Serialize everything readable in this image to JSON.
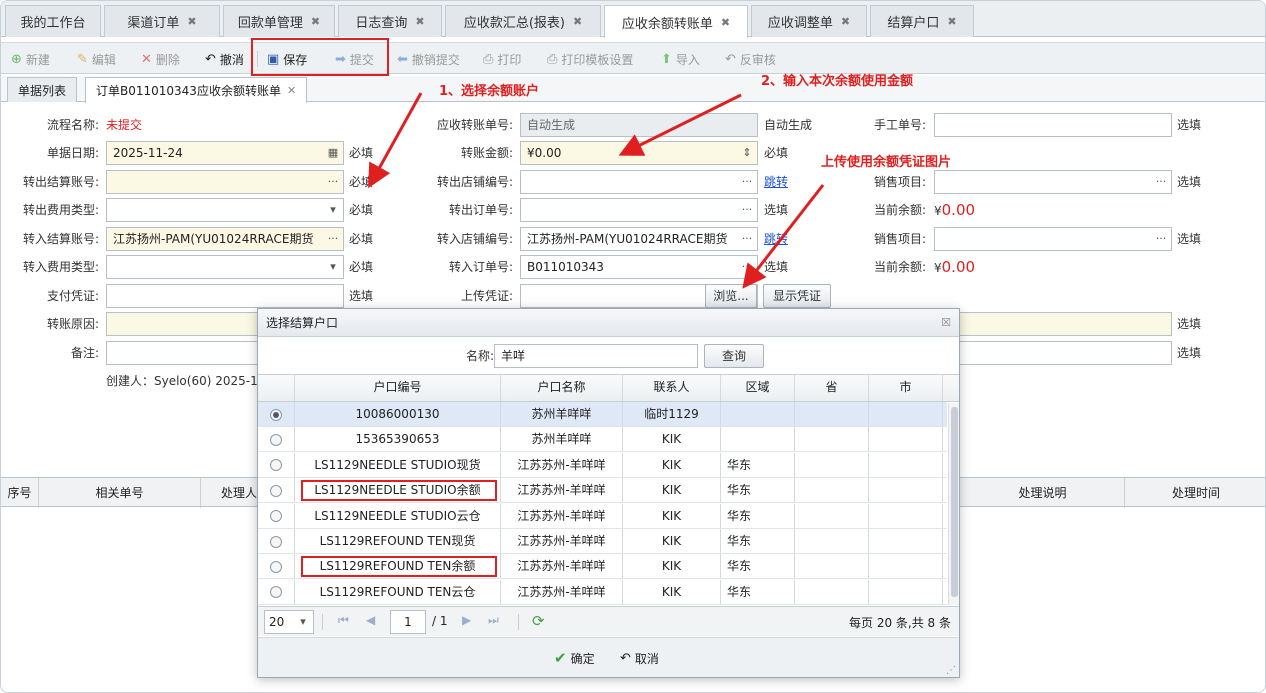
{
  "tabs": [
    {
      "label": "我的工作台",
      "closable": false
    },
    {
      "label": "渠道订单",
      "closable": true
    },
    {
      "label": "回款单管理",
      "closable": true
    },
    {
      "label": "日志查询",
      "closable": true
    },
    {
      "label": "应收款汇总(报表)",
      "closable": true
    },
    {
      "label": "应收余额转账单",
      "closable": true,
      "active": true
    },
    {
      "label": "应收调整单",
      "closable": true
    },
    {
      "label": "结算户口",
      "closable": true
    }
  ],
  "close_glyph": "✖",
  "toolbar": {
    "new": "新建",
    "edit": "编辑",
    "delete": "删除",
    "undo": "撤消",
    "save": "保存",
    "submit": "提交",
    "revoke_submit": "撤销提交",
    "print": "打印",
    "print_template": "打印模板设置",
    "import": "导入",
    "unaudit": "反审核"
  },
  "subtabs": {
    "list": "单据列表",
    "doc": "订单B011010343应收余额转账单"
  },
  "form": {
    "flow_name_label": "流程名称:",
    "flow_name_value": "未提交",
    "doc_date_label": "单据日期:",
    "doc_date_value": "2025-11-24",
    "out_account_label": "转出结算账号:",
    "out_fee_type_label": "转出费用类型:",
    "in_account_label": "转入结算账号:",
    "in_account_value": "江苏扬州-PAM(YU01024RRACE期货",
    "in_fee_type_label": "转入费用类型:",
    "pay_voucher_label": "支付凭证:",
    "reason_label": "转账原因:",
    "remark_label": "备注:",
    "transfer_no_label": "应收转账单号:",
    "transfer_no_value": "自动生成",
    "amount_label": "转账金额:",
    "amount_value": "¥0.00",
    "out_store_label": "转出店铺编号:",
    "out_order_label": "转出订单号:",
    "in_store_label": "转入店铺编号:",
    "in_store_value": "江苏扬州-PAM(YU01024RRACE期货",
    "in_order_label": "转入订单号:",
    "in_order_value": "B011010343",
    "upload_label": "上传凭证:",
    "browse": "浏览...",
    "show_voucher": "显示凭证",
    "manual_no_label": "手工单号:",
    "sales_item_label": "销售项目:",
    "balance_label": "当前余额:",
    "balance_symbol": "¥",
    "balance_value": "0.00",
    "required": "必填",
    "optional": "选填",
    "auto": "自动生成",
    "jump": "跳转",
    "creator_text": "创建人：Syelo(60) 2025-11-"
  },
  "annotations": {
    "a1": "1、选择余额账户",
    "a2": "2、输入本次余额使用金额",
    "a3": "上传使用余额凭证图片"
  },
  "bottom_grid": {
    "headers": [
      "序号",
      "相关单号",
      "处理人",
      "处理说明",
      "处理时间"
    ]
  },
  "dialog": {
    "title": "选择结算户口",
    "name_label": "名称:",
    "name_value": "羊咩",
    "query": "查询",
    "columns": [
      "户口编号",
      "户口名称",
      "联系人",
      "区域",
      "省",
      "市"
    ],
    "rows": [
      {
        "code": "10086000130",
        "name": "苏州羊咩咩",
        "contact": "临时1129",
        "region": "",
        "province": "",
        "city": "",
        "selected": true
      },
      {
        "code": "15365390653",
        "name": "苏州羊咩咩",
        "contact": "KIK",
        "region": "",
        "province": "",
        "city": ""
      },
      {
        "code": "LS1129NEEDLE STUDIO现货",
        "name": "江苏苏州-羊咩咩",
        "contact": "KIK",
        "region": "华东",
        "province": "",
        "city": ""
      },
      {
        "code": "LS1129NEEDLE STUDIO余额",
        "name": "江苏苏州-羊咩咩",
        "contact": "KIK",
        "region": "华东",
        "province": "",
        "city": "",
        "boxed": true
      },
      {
        "code": "LS1129NEEDLE STUDIO云仓",
        "name": "江苏苏州-羊咩咩",
        "contact": "KIK",
        "region": "华东",
        "province": "",
        "city": ""
      },
      {
        "code": "LS1129REFOUND TEN现货",
        "name": "江苏苏州-羊咩咩",
        "contact": "KIK",
        "region": "华东",
        "province": "",
        "city": ""
      },
      {
        "code": "LS1129REFOUND TEN余额",
        "name": "江苏苏州-羊咩咩",
        "contact": "KIK",
        "region": "华东",
        "province": "",
        "city": "",
        "boxed": true
      },
      {
        "code": "LS1129REFOUND TEN云仓",
        "name": "江苏苏州-羊咩咩",
        "contact": "KIK",
        "region": "华东",
        "province": "",
        "city": ""
      }
    ],
    "page_size": "20",
    "page": "1",
    "page_total": "/ 1",
    "summary": "每页 20 条,共 8 条",
    "ok": "确定",
    "cancel": "取消"
  },
  "colors": {
    "accent_red": "#e02020",
    "link": "#1a4fd6",
    "required_bg": "#fbf8e4"
  }
}
